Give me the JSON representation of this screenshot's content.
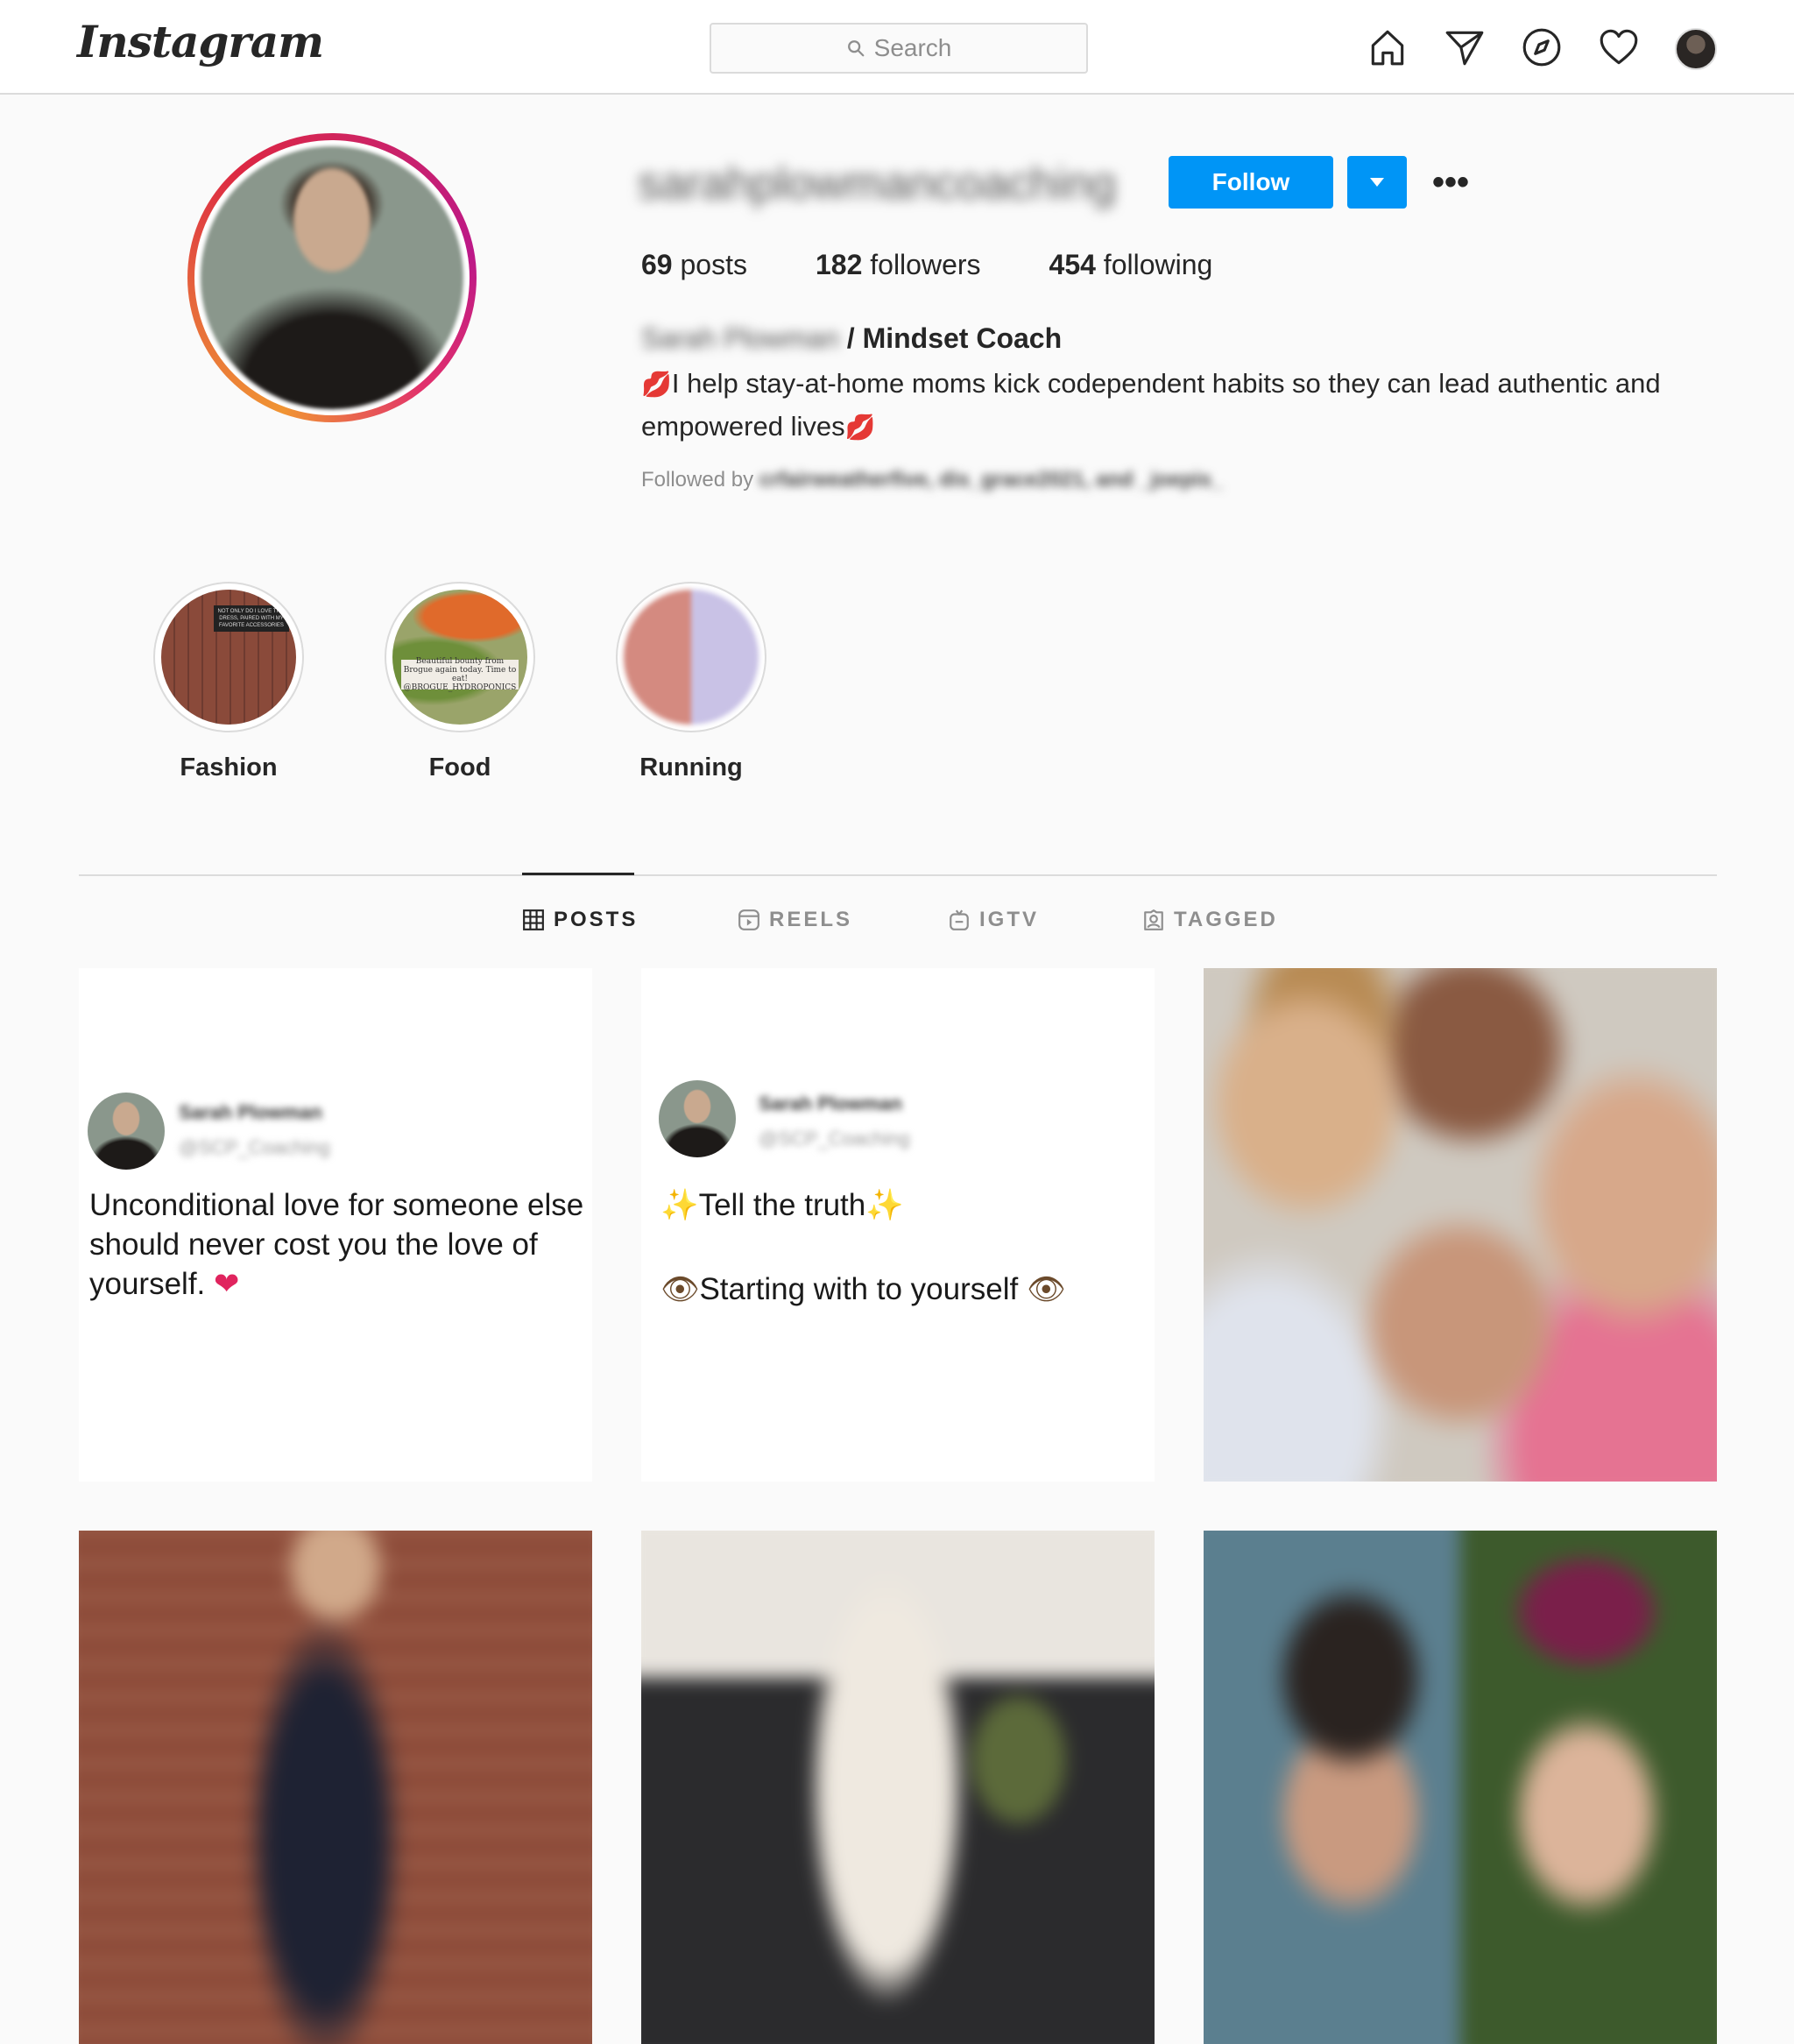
{
  "nav": {
    "logo": "Instagram",
    "search_placeholder": "Search",
    "icons": [
      "home-icon",
      "direct-message-icon",
      "explore-compass-icon",
      "activity-heart-icon",
      "profile-avatar"
    ]
  },
  "profile": {
    "username": "sarahplowmancoaching",
    "follow_label": "Follow",
    "more_label": "•••",
    "stats": {
      "posts_count": "69",
      "posts_label": "posts",
      "followers_count": "182",
      "followers_label": "followers",
      "following_count": "454",
      "following_label": "following"
    },
    "full_name": "Sarah Plowman",
    "title": "/ Mindset Coach",
    "bio_emoji": "💋",
    "bio_text": "I help stay-at-home moms kick codependent habits so they can lead authentic and empowered lives",
    "followed_by_prefix": "Followed by",
    "followed_by_names": "crfairweatherfive, dis_grace2021, and _joepis_"
  },
  "highlights": [
    {
      "label": "Fashion",
      "caption": "NOT ONLY DO I LOVE THIS DRESS, PAIRED WITH MY FAVORITE ACCESSORIES"
    },
    {
      "label": "Food",
      "caption": "Beautiful bounty from Brogue again today. Time to eat!",
      "tag": "@BROGUE_HYDROPONICS"
    },
    {
      "label": "Running"
    }
  ],
  "tabs": [
    {
      "label": "POSTS",
      "icon": "grid-icon",
      "active": true
    },
    {
      "label": "REELS",
      "icon": "reels-icon",
      "active": false
    },
    {
      "label": "IGTV",
      "icon": "igtv-icon",
      "active": false
    },
    {
      "label": "TAGGED",
      "icon": "tagged-icon",
      "active": false
    }
  ],
  "posts": [
    {
      "type": "tweet",
      "author": "Sarah Plowman",
      "handle": "@SCP_Coaching",
      "text": "Unconditional love for someone else should never cost you the love of yourself.",
      "emoji": "❤"
    },
    {
      "type": "tweet",
      "author": "Sarah Plowman",
      "handle": "@SCP_Coaching",
      "line1": "Tell the truth",
      "line2": "Starting with to yourself",
      "sparkle": "✨",
      "eye": "👁"
    },
    {
      "type": "photo"
    },
    {
      "type": "photo"
    },
    {
      "type": "photo"
    },
    {
      "type": "photo"
    }
  ]
}
